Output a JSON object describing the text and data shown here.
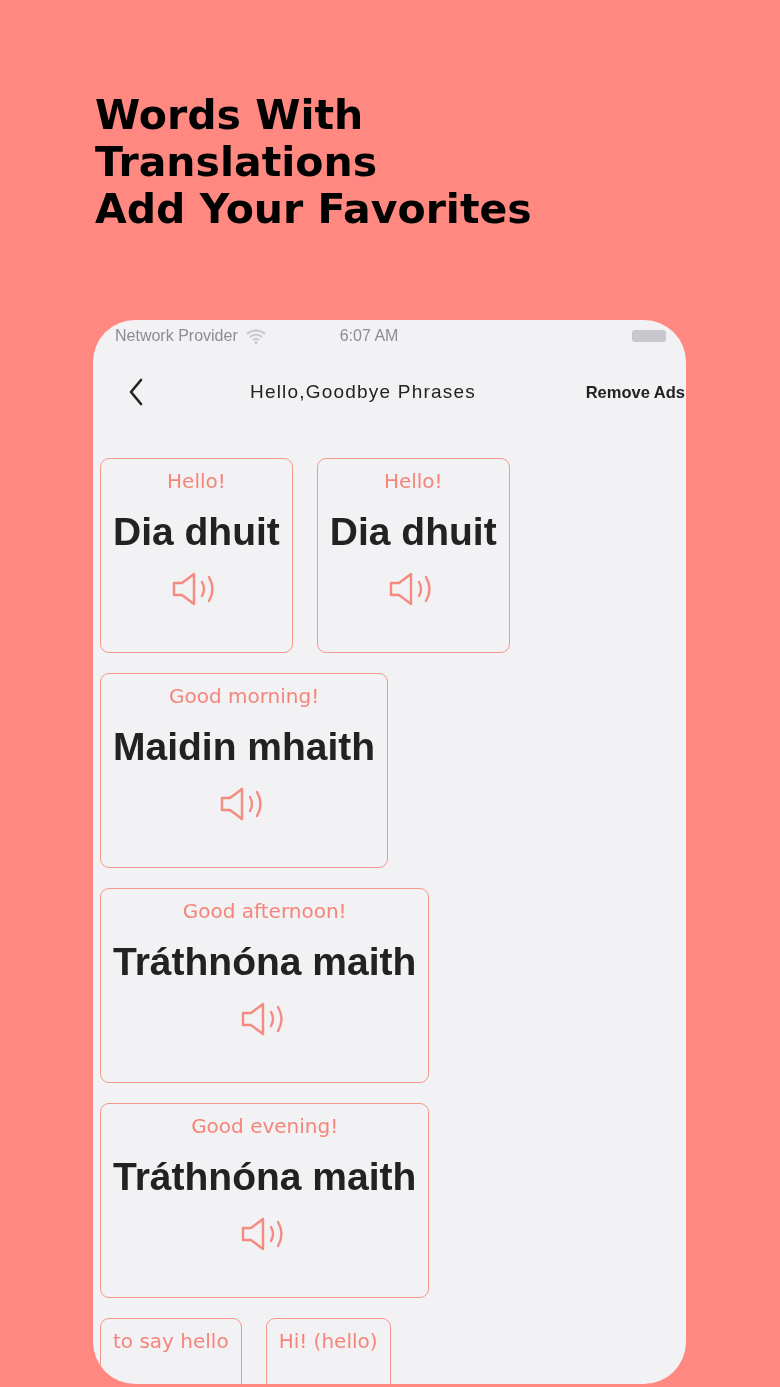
{
  "headline": [
    "Words With",
    "Translations",
    "Add Your Favorites"
  ],
  "status_bar": {
    "carrier": "Network Provider",
    "time": "6:07 AM"
  },
  "nav": {
    "title": "Hello,Goodbye Phrases",
    "action": "Remove Ads"
  },
  "cards": [
    {
      "translation": "Hello!",
      "phrase": "Dia dhuit"
    },
    {
      "translation": "Hello!",
      "phrase": "Dia dhuit"
    },
    {
      "translation": "Good morning!",
      "phrase": "Maidin mhaith"
    },
    {
      "translation": "Good afternoon!",
      "phrase": "Tráthnóna maith"
    },
    {
      "translation": "Good evening!",
      "phrase": "Tráthnóna maith"
    },
    {
      "translation": "to say hello"
    },
    {
      "translation": "Hi! (hello)"
    }
  ]
}
